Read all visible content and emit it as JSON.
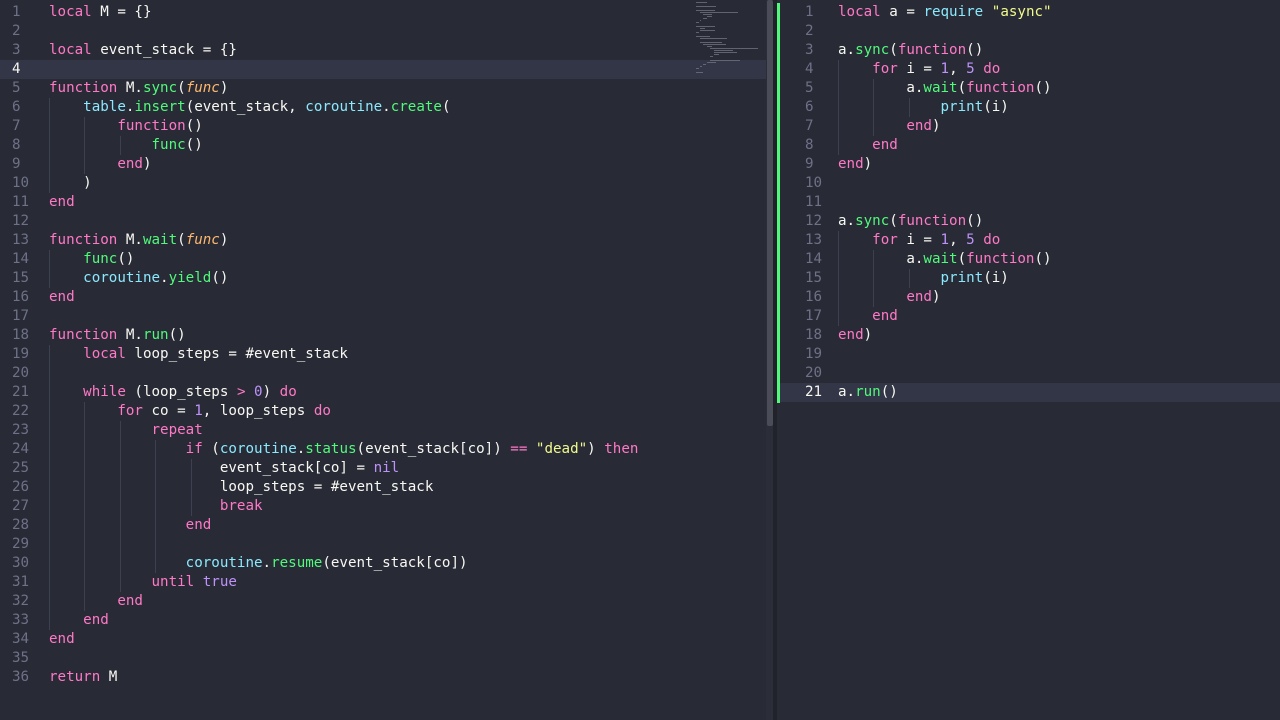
{
  "left_editor": {
    "current_line": 4,
    "lines": [
      [
        [
          "k",
          "local"
        ],
        [
          "w",
          " M = {}"
        ]
      ],
      [],
      [
        [
          "k",
          "local"
        ],
        [
          "w",
          " event_stack = {}"
        ]
      ],
      [],
      [
        [
          "k",
          "function"
        ],
        [
          "w",
          " M."
        ],
        [
          "f",
          "sync"
        ],
        [
          "w",
          "("
        ],
        [
          "p",
          "func"
        ],
        [
          "w",
          ")"
        ]
      ],
      [
        [
          "w",
          "    "
        ],
        [
          "b",
          "table"
        ],
        [
          "w",
          "."
        ],
        [
          "f",
          "insert"
        ],
        [
          "w",
          "(event_stack, "
        ],
        [
          "b",
          "coroutine"
        ],
        [
          "w",
          "."
        ],
        [
          "f",
          "create"
        ],
        [
          "w",
          "("
        ]
      ],
      [
        [
          "w",
          "        "
        ],
        [
          "k",
          "function"
        ],
        [
          "w",
          "()"
        ]
      ],
      [
        [
          "w",
          "            "
        ],
        [
          "f",
          "func"
        ],
        [
          "w",
          "()"
        ]
      ],
      [
        [
          "w",
          "        "
        ],
        [
          "k",
          "end"
        ],
        [
          "w",
          ")"
        ]
      ],
      [
        [
          "w",
          "    )"
        ]
      ],
      [
        [
          "k",
          "end"
        ]
      ],
      [],
      [
        [
          "k",
          "function"
        ],
        [
          "w",
          " M."
        ],
        [
          "f",
          "wait"
        ],
        [
          "w",
          "("
        ],
        [
          "p",
          "func"
        ],
        [
          "w",
          ")"
        ]
      ],
      [
        [
          "w",
          "    "
        ],
        [
          "f",
          "func"
        ],
        [
          "w",
          "()"
        ]
      ],
      [
        [
          "w",
          "    "
        ],
        [
          "b",
          "coroutine"
        ],
        [
          "w",
          "."
        ],
        [
          "f",
          "yield"
        ],
        [
          "w",
          "()"
        ]
      ],
      [
        [
          "k",
          "end"
        ]
      ],
      [],
      [
        [
          "k",
          "function"
        ],
        [
          "w",
          " M."
        ],
        [
          "f",
          "run"
        ],
        [
          "w",
          "()"
        ]
      ],
      [
        [
          "w",
          "    "
        ],
        [
          "k",
          "local"
        ],
        [
          "w",
          " loop_steps = #event_stack"
        ]
      ],
      [],
      [
        [
          "w",
          "    "
        ],
        [
          "k",
          "while"
        ],
        [
          "w",
          " (loop_steps "
        ],
        [
          "k",
          ">"
        ],
        [
          "w",
          " "
        ],
        [
          "n",
          "0"
        ],
        [
          "w",
          ") "
        ],
        [
          "k",
          "do"
        ]
      ],
      [
        [
          "w",
          "        "
        ],
        [
          "k",
          "for"
        ],
        [
          "w",
          " co = "
        ],
        [
          "n",
          "1"
        ],
        [
          "w",
          ", loop_steps "
        ],
        [
          "k",
          "do"
        ]
      ],
      [
        [
          "w",
          "            "
        ],
        [
          "k",
          "repeat"
        ]
      ],
      [
        [
          "w",
          "                "
        ],
        [
          "k",
          "if"
        ],
        [
          "w",
          " ("
        ],
        [
          "b",
          "coroutine"
        ],
        [
          "w",
          "."
        ],
        [
          "f",
          "status"
        ],
        [
          "w",
          "(event_stack[co]) "
        ],
        [
          "k",
          "=="
        ],
        [
          "w",
          " "
        ],
        [
          "s",
          "\"dead\""
        ],
        [
          "w",
          ") "
        ],
        [
          "k",
          "then"
        ]
      ],
      [
        [
          "w",
          "                    event_stack[co] = "
        ],
        [
          "n",
          "nil"
        ]
      ],
      [
        [
          "w",
          "                    loop_steps = #event_stack"
        ]
      ],
      [
        [
          "w",
          "                    "
        ],
        [
          "k",
          "break"
        ]
      ],
      [
        [
          "w",
          "                "
        ],
        [
          "k",
          "end"
        ]
      ],
      [],
      [
        [
          "w",
          "                "
        ],
        [
          "b",
          "coroutine"
        ],
        [
          "w",
          "."
        ],
        [
          "f",
          "resume"
        ],
        [
          "w",
          "(event_stack[co])"
        ]
      ],
      [
        [
          "w",
          "            "
        ],
        [
          "k",
          "until"
        ],
        [
          "w",
          " "
        ],
        [
          "n",
          "true"
        ]
      ],
      [
        [
          "w",
          "        "
        ],
        [
          "k",
          "end"
        ]
      ],
      [
        [
          "w",
          "    "
        ],
        [
          "k",
          "end"
        ]
      ],
      [
        [
          "k",
          "end"
        ]
      ],
      [],
      [
        [
          "k",
          "return"
        ],
        [
          "w",
          " M"
        ]
      ]
    ]
  },
  "right_editor": {
    "current_line": 21,
    "lines": [
      [
        [
          "k",
          "local"
        ],
        [
          "w",
          " a = "
        ],
        [
          "b",
          "require"
        ],
        [
          "w",
          " "
        ],
        [
          "s",
          "\"async\""
        ]
      ],
      [],
      [
        [
          "w",
          "a."
        ],
        [
          "f",
          "sync"
        ],
        [
          "w",
          "("
        ],
        [
          "k",
          "function"
        ],
        [
          "w",
          "()"
        ]
      ],
      [
        [
          "w",
          "    "
        ],
        [
          "k",
          "for"
        ],
        [
          "w",
          " i = "
        ],
        [
          "n",
          "1"
        ],
        [
          "w",
          ", "
        ],
        [
          "n",
          "5"
        ],
        [
          "w",
          " "
        ],
        [
          "k",
          "do"
        ]
      ],
      [
        [
          "w",
          "        a."
        ],
        [
          "f",
          "wait"
        ],
        [
          "w",
          "("
        ],
        [
          "k",
          "function"
        ],
        [
          "w",
          "()"
        ]
      ],
      [
        [
          "w",
          "            "
        ],
        [
          "b",
          "print"
        ],
        [
          "w",
          "(i)"
        ]
      ],
      [
        [
          "w",
          "        "
        ],
        [
          "k",
          "end"
        ],
        [
          "w",
          ")"
        ]
      ],
      [
        [
          "w",
          "    "
        ],
        [
          "k",
          "end"
        ]
      ],
      [
        [
          "k",
          "end"
        ],
        [
          "w",
          ")"
        ]
      ],
      [],
      [],
      [
        [
          "w",
          "a."
        ],
        [
          "f",
          "sync"
        ],
        [
          "w",
          "("
        ],
        [
          "k",
          "function"
        ],
        [
          "w",
          "()"
        ]
      ],
      [
        [
          "w",
          "    "
        ],
        [
          "k",
          "for"
        ],
        [
          "w",
          " i = "
        ],
        [
          "n",
          "1"
        ],
        [
          "w",
          ", "
        ],
        [
          "n",
          "5"
        ],
        [
          "w",
          " "
        ],
        [
          "k",
          "do"
        ]
      ],
      [
        [
          "w",
          "        a."
        ],
        [
          "f",
          "wait"
        ],
        [
          "w",
          "("
        ],
        [
          "k",
          "function"
        ],
        [
          "w",
          "()"
        ]
      ],
      [
        [
          "w",
          "            "
        ],
        [
          "b",
          "print"
        ],
        [
          "w",
          "(i)"
        ]
      ],
      [
        [
          "w",
          "        "
        ],
        [
          "k",
          "end"
        ],
        [
          "w",
          ")"
        ]
      ],
      [
        [
          "w",
          "    "
        ],
        [
          "k",
          "end"
        ]
      ],
      [
        [
          "k",
          "end"
        ],
        [
          "w",
          ")"
        ]
      ],
      [],
      [],
      [
        [
          "w",
          "a."
        ],
        [
          "f",
          "run"
        ],
        [
          "w",
          "()"
        ]
      ]
    ]
  },
  "colors": {
    "background": "#282a36",
    "keyword": "#ff79c6",
    "function": "#50fa7b",
    "builtin": "#8be9fd",
    "parameter": "#ffb86c",
    "number": "#bd93f9",
    "string": "#f1fa8c",
    "active_border": "#50fa7b"
  }
}
